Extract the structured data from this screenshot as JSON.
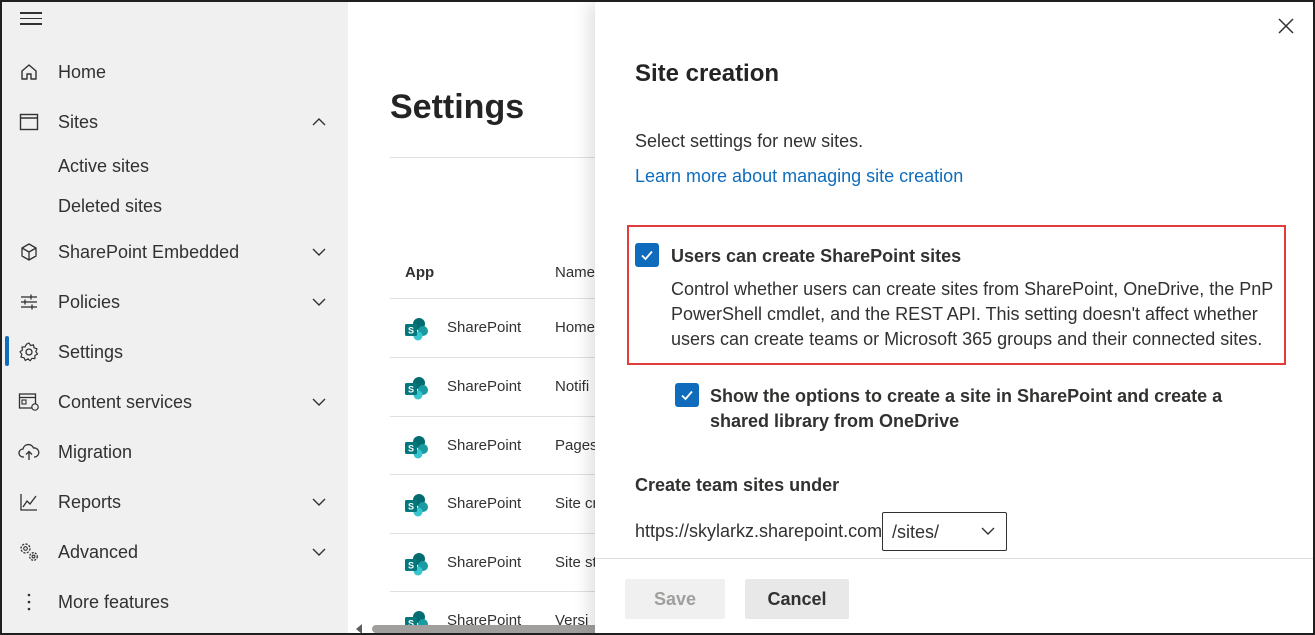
{
  "sidebar": {
    "items": [
      {
        "label": "Home",
        "icon": "home-icon"
      },
      {
        "label": "Sites",
        "icon": "browser-window-icon",
        "expanded": true,
        "children": [
          {
            "label": "Active sites"
          },
          {
            "label": "Deleted sites"
          }
        ]
      },
      {
        "label": "SharePoint Embedded",
        "icon": "cube-icon"
      },
      {
        "label": "Policies",
        "icon": "sliders-icon"
      },
      {
        "label": "Settings",
        "icon": "gear-icon",
        "active": true
      },
      {
        "label": "Content services",
        "icon": "content-services-icon"
      },
      {
        "label": "Migration",
        "icon": "cloud-upload-icon"
      },
      {
        "label": "Reports",
        "icon": "line-chart-icon"
      },
      {
        "label": "Advanced",
        "icon": "gears-icon"
      },
      {
        "label": "More features",
        "icon": "more-vertical-icon"
      }
    ]
  },
  "main": {
    "title": "Settings",
    "columns": {
      "app": "App",
      "name": "Name"
    },
    "rows": [
      {
        "app": "SharePoint",
        "name": "Home"
      },
      {
        "app": "SharePoint",
        "name": "Notifi"
      },
      {
        "app": "SharePoint",
        "name": "Pages"
      },
      {
        "app": "SharePoint",
        "name": "Site cr"
      },
      {
        "app": "SharePoint",
        "name": "Site st"
      },
      {
        "app": "SharePoint",
        "name": "Versi"
      }
    ]
  },
  "panel": {
    "title": "Site creation",
    "description": "Select settings for new sites.",
    "learn_more": "Learn more about managing site creation",
    "option1": {
      "checked": true,
      "label": "Users can create SharePoint sites",
      "description": "Control whether users can create sites from SharePoint, OneDrive, the PnP PowerShell cmdlet, and the REST API. This setting doesn't affect whether users can create teams or Microsoft 365 groups and their connected sites."
    },
    "option2": {
      "checked": true,
      "label": "Show the options to create a site in SharePoint and create a shared library from OneDrive"
    },
    "team_sites_label": "Create team sites under",
    "url_prefix": "https://skylarkz.sharepoint.com",
    "path_selected": "/sites/",
    "save": "Save",
    "cancel": "Cancel"
  },
  "colors": {
    "accent": "#0f6cbd",
    "highlight": "#e23b3b",
    "sidebar_bg": "#f0f0f0"
  }
}
